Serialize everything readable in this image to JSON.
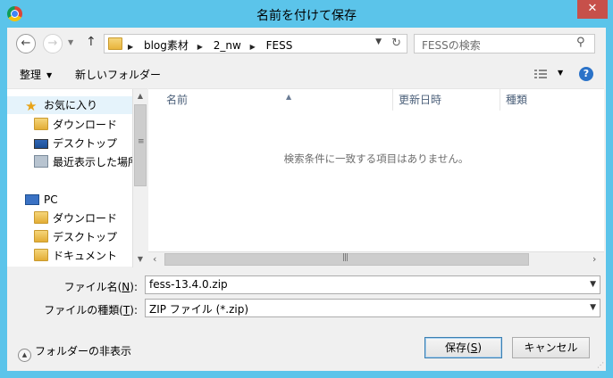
{
  "window": {
    "title": "名前を付けて保存",
    "close_label": "✕"
  },
  "address": {
    "crumbs": [
      "blog素材",
      "2_nw",
      "FESS"
    ]
  },
  "search": {
    "placeholder": "FESSの検索"
  },
  "toolbar": {
    "organize": "整理",
    "new_folder": "新しいフォルダー"
  },
  "nav_tree": {
    "favorites": "お気に入り",
    "favorites_items": [
      "ダウンロード",
      "デスクトップ",
      "最近表示した場所"
    ],
    "pc": "PC",
    "pc_items": [
      "ダウンロード",
      "デスクトップ",
      "ドキュメント"
    ]
  },
  "file_list": {
    "columns": [
      "名前",
      "更新日時",
      "種類"
    ],
    "empty_message": "検索条件に一致する項目はありません。"
  },
  "form": {
    "filename_label": "ファイル名(",
    "filename_key": "N",
    "filename_suffix": "):",
    "filename_value": "fess-13.4.0.zip",
    "filetype_label": "ファイルの種類(",
    "filetype_key": "T",
    "filetype_suffix": "):",
    "filetype_value": "ZIP ファイル (*.zip)"
  },
  "footer": {
    "hide_folders": "フォルダーの非表示",
    "save_label": "保存(",
    "save_key": "S",
    "save_suffix": ")",
    "cancel_label": "キャンセル"
  },
  "colors": {
    "titlebar": "#5bc4ea",
    "close": "#c7504a",
    "selected": "#e5f3fb"
  }
}
